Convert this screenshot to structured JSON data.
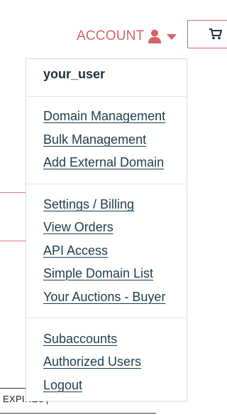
{
  "header": {
    "account_label": "ACCOUNT",
    "account_icon": "user-icon",
    "caret_icon": "caret-down-icon",
    "cart_icon": "shopping-cart-icon",
    "accent_color": "#d5616b"
  },
  "dropdown": {
    "username": "your_user",
    "group1": [
      "Domain Management",
      "Bulk Management",
      "Add External Domain"
    ],
    "group2": [
      "Settings / Billing",
      "View Orders",
      "API Access",
      "Simple Domain List",
      "Your Auctions - Buyer"
    ],
    "group3": [
      "Subaccounts",
      "Authorized Users",
      "Logout"
    ]
  },
  "background": {
    "expires_label": "EXPIRES"
  }
}
